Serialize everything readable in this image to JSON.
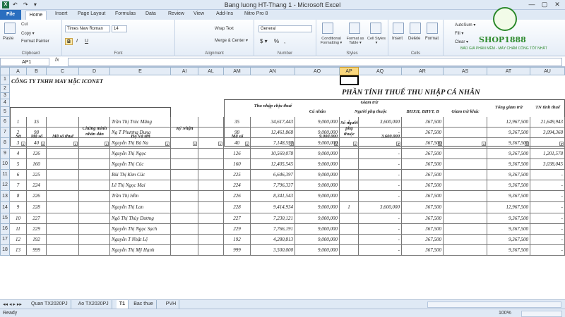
{
  "app": {
    "title": "Bang luong HT-Thang 1 - Microsoft Excel",
    "qat": "↶ ↷ ▾",
    "min": "—",
    "max": "▢",
    "close": "✕"
  },
  "menu": {
    "file": "File",
    "tabs": [
      "Home",
      "Insert",
      "Page Layout",
      "Formulas",
      "Data",
      "Review",
      "View",
      "Add-Ins",
      "Nitro Pro 8"
    ]
  },
  "ribbon": {
    "clipboard": {
      "paste": "Paste",
      "cut": "Cut",
      "copy": "Copy ▾",
      "format_painter": "Format Painter",
      "label": "Clipboard"
    },
    "font": {
      "family": "Times New Roman",
      "size": "14",
      "bold": "B",
      "italic": "I",
      "underline": "U",
      "label": "Font"
    },
    "alignment": {
      "wrap": "Wrap Text",
      "merge": "Merge & Center ▾",
      "label": "Alignment"
    },
    "number": {
      "format": "General",
      "currency": "$ ▾",
      "percent": "%",
      "comma": ",",
      "label": "Number"
    },
    "styles": {
      "conditional": "Conditional Formatting ▾",
      "as_table": "Format as Table ▾",
      "cell_styles": "Cell Styles ▾",
      "label": "Styles"
    },
    "cells": {
      "insert": "Insert",
      "delete": "Delete",
      "format": "Format",
      "label": "Cells"
    },
    "editing": {
      "autosum": "AutoSum ▾",
      "fill": "Fill ▾",
      "clear": "Clear ▾"
    }
  },
  "logo": {
    "name": "SHOP1888",
    "slogan": "BÁO GIÁ PHẦN MỀM - MÁY CHẤM CÔNG TỐT NHẤT"
  },
  "formula": {
    "name_box": "AP1",
    "fx": "fx",
    "value": ""
  },
  "columns": [
    "A",
    "B",
    "C",
    "D",
    "E",
    "AI",
    "AL",
    "AM",
    "AN",
    "AO",
    "AP",
    "AQ",
    "AR",
    "AS",
    "AT",
    "AU"
  ],
  "row_numbers": [
    "1",
    "2",
    "3",
    "4",
    "5",
    "6",
    "7",
    "8",
    "9",
    "10",
    "11",
    "12",
    "13",
    "14",
    "15",
    "16",
    "17",
    "18"
  ],
  "sheet": {
    "company": "CÔNG TY TNHH MAY MẶC ICONET",
    "title": "PHẦN TÍNH THUẾ THU NHẬP CÁ NHÂN",
    "headers": {
      "stt": "Stt",
      "maso": "Mã số",
      "masothue": "Mã số thuế",
      "cmnd": "Chứng minh nhân dân",
      "hoten": "Họ Và tên",
      "kynhan": "Ký Nhận",
      "maso2": "Mã số",
      "thunhap": "Thu nhập chịu thuế",
      "giamtru": "Giảm trừ",
      "canhan": "Cá nhân",
      "phuthuoc": "Người phụ thuộc",
      "songuoi": "Số người phụ thuộc",
      "bhxh": "BHXH, BHYT, B",
      "giamtrukhac": "Giảm trừ khác",
      "tonggiamtru": "Tổng giảm trừ",
      "tntinhthue": "TN tính thuế",
      "canhan_val": "9,000,000",
      "phuthuoc_val": "3,600,000"
    },
    "rows": [
      {
        "stt": "1",
        "maso": "35",
        "name": "Trần Thị Trúc Mãng",
        "maso2": "35",
        "thunhap": "34,617,443",
        "canhan": "9,000,000",
        "songuoi": "1",
        "phuthuoc": "3,600,000",
        "bhxh": "367,500",
        "tong": "12,967,500",
        "tntt": "21,649,943"
      },
      {
        "stt": "2",
        "maso": "98",
        "name": "Ng T Phương Dung",
        "maso2": "98",
        "thunhap": "12,461,868",
        "canhan": "9,000,000",
        "songuoi": "",
        "phuthuoc": "-",
        "bhxh": "367,500",
        "tong": "9,367,500",
        "tntt": "3,094,368"
      },
      {
        "stt": "3",
        "maso": "40",
        "name": "Nguyễn Thị Bá Na",
        "maso2": "40",
        "thunhap": "7,148,550",
        "canhan": "9,000,000",
        "songuoi": "",
        "phuthuoc": "-",
        "bhxh": "367,500",
        "tong": "9,367,500",
        "tntt": "-"
      },
      {
        "stt": "4",
        "maso": "126",
        "name": "Nguyễn Thị Ngọc",
        "maso2": "126",
        "thunhap": "10,569,078",
        "canhan": "9,000,000",
        "songuoi": "",
        "phuthuoc": "-",
        "bhxh": "367,500",
        "tong": "9,367,500",
        "tntt": "1,201,578"
      },
      {
        "stt": "5",
        "maso": "160",
        "name": "Nguyễn Thị Cúc",
        "maso2": "160",
        "thunhap": "12,405,545",
        "canhan": "9,000,000",
        "songuoi": "",
        "phuthuoc": "-",
        "bhxh": "367,500",
        "tong": "9,367,500",
        "tntt": "3,038,045"
      },
      {
        "stt": "6",
        "maso": "225",
        "name": "Bùi Thị Kim Cúc",
        "maso2": "225",
        "thunhap": "6,646,397",
        "canhan": "9,000,000",
        "songuoi": "",
        "phuthuoc": "-",
        "bhxh": "367,500",
        "tong": "9,367,500",
        "tntt": "-"
      },
      {
        "stt": "7",
        "maso": "224",
        "name": "Lê Thị Ngọc Mai",
        "maso2": "224",
        "thunhap": "7,796,337",
        "canhan": "9,000,000",
        "songuoi": "",
        "phuthuoc": "-",
        "bhxh": "367,500",
        "tong": "9,367,500",
        "tntt": "-"
      },
      {
        "stt": "8",
        "maso": "226",
        "name": "Trần Thị Hồn",
        "maso2": "226",
        "thunhap": "8,341,543",
        "canhan": "9,000,000",
        "songuoi": "",
        "phuthuoc": "-",
        "bhxh": "367,500",
        "tong": "9,367,500",
        "tntt": "-"
      },
      {
        "stt": "9",
        "maso": "228",
        "name": "Nguyễn Thị Lan",
        "maso2": "228",
        "thunhap": "9,414,934",
        "canhan": "9,000,000",
        "songuoi": "1",
        "phuthuoc": "3,600,000",
        "bhxh": "367,500",
        "tong": "12,967,500",
        "tntt": "-"
      },
      {
        "stt": "10",
        "maso": "227",
        "name": "Ngô Thị Thùy Dương",
        "maso2": "227",
        "thunhap": "7,230,121",
        "canhan": "9,000,000",
        "songuoi": "",
        "phuthuoc": "-",
        "bhxh": "367,500",
        "tong": "9,367,500",
        "tntt": "-"
      },
      {
        "stt": "11",
        "maso": "229",
        "name": "Nguyễn Thị Ngọc Sạch",
        "maso2": "229",
        "thunhap": "7,766,191",
        "canhan": "9,000,000",
        "songuoi": "",
        "phuthuoc": "-",
        "bhxh": "367,500",
        "tong": "9,367,500",
        "tntt": "-"
      },
      {
        "stt": "12",
        "maso": "192",
        "name": "Nguyễn T Nhật Lệ",
        "maso2": "192",
        "thunhap": "4,280,813",
        "canhan": "9,000,000",
        "songuoi": "",
        "phuthuoc": "-",
        "bhxh": "367,500",
        "tong": "9,367,500",
        "tntt": "-"
      },
      {
        "stt": "13",
        "maso": "999",
        "name": "Nguyễn Thị Mỹ Hạnh",
        "maso2": "999",
        "thunhap": "3,500,000",
        "canhan": "9,000,000",
        "songuoi": "",
        "phuthuoc": "-",
        "bhxh": "367,500",
        "tong": "9,367,500",
        "tntt": "-"
      }
    ]
  },
  "sheets": [
    "Quan TX2020PJ",
    "Ao TX2020PJ",
    "T1",
    "Bac thue",
    "PVH"
  ],
  "active_sheet": 2,
  "status": {
    "ready": "Ready",
    "zoom": "100%"
  }
}
